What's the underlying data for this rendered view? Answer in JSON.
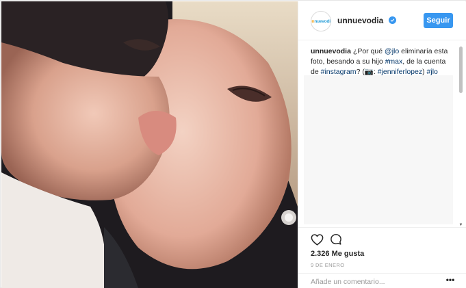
{
  "post": {
    "photo_alt": "photo",
    "colors": {
      "accent": "#3897f0",
      "text": "#262626",
      "muted": "#999999",
      "link": "#003569",
      "border": "#efefef"
    }
  },
  "header": {
    "avatar_text_1": "un",
    "avatar_text_2": "nuevodia",
    "username": "unnuevodia",
    "verified_icon": "verified-badge-icon",
    "follow_label": "Seguir"
  },
  "caption": {
    "username": "unnuevodia",
    "text_1": "¿Por qué ",
    "mention": "@jlo",
    "text_2": " eliminaría esta foto, besando a su hijo ",
    "tag_max": "#max",
    "text_3": ", de la cuenta de ",
    "tag_instagram": "#instagram",
    "text_4": "? (📷: ",
    "tag_jennifer": "#jenniferlopez",
    "text_5": ") ",
    "tag_jlo": "#jlo"
  },
  "actions": {
    "like_icon": "heart-icon",
    "comment_icon": "comment-bubble-icon",
    "likes_label": "2.326 Me gusta",
    "date": "9 DE ENERO"
  },
  "comment_form": {
    "placeholder": "Añade un comentario...",
    "more_label": "•••"
  }
}
